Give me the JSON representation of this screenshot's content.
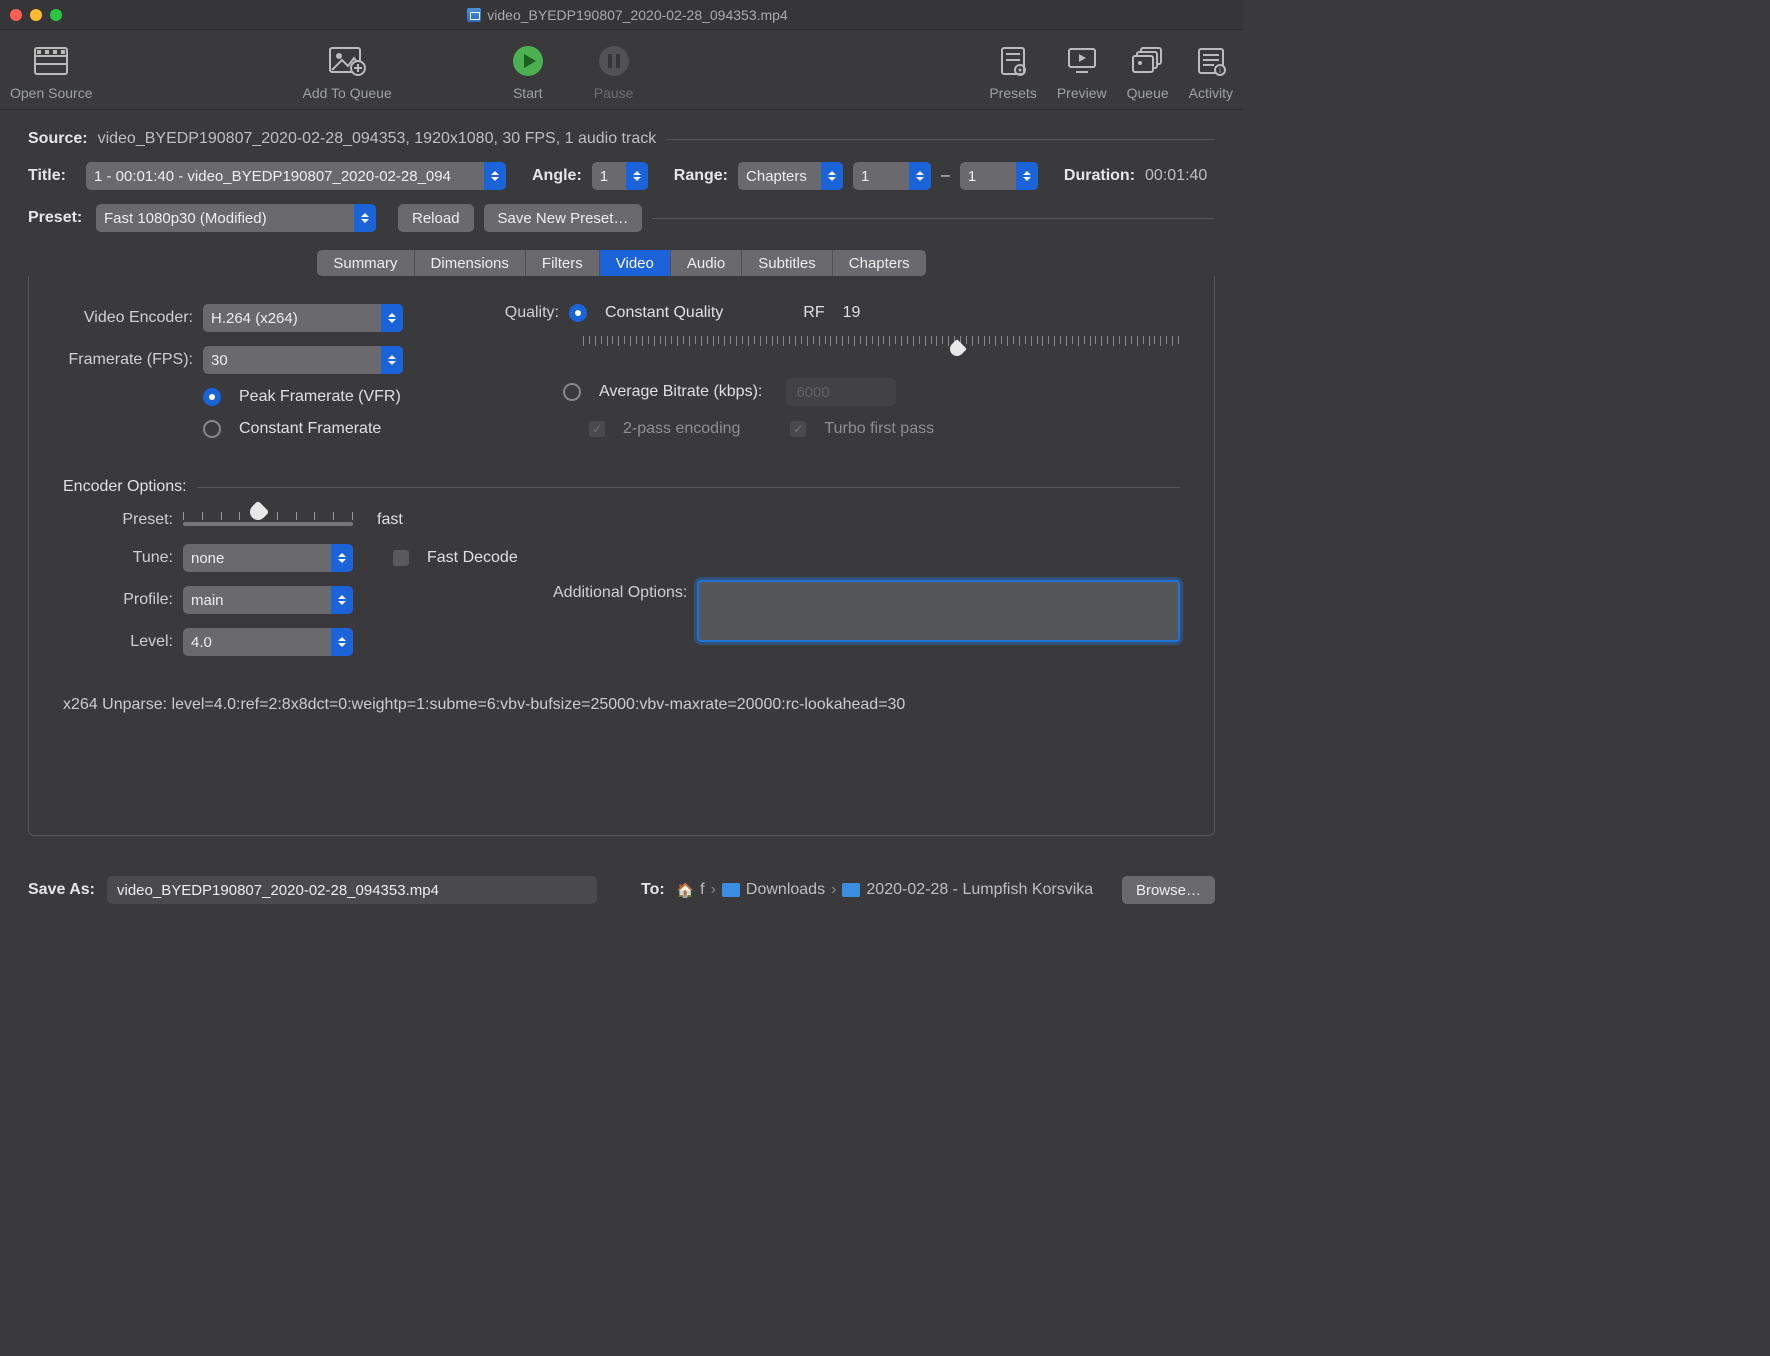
{
  "window": {
    "title": "video_BYEDP190807_2020-02-28_094353.mp4"
  },
  "toolbar": {
    "open_source": "Open Source",
    "add_to_queue": "Add To Queue",
    "start": "Start",
    "pause": "Pause",
    "presets": "Presets",
    "preview": "Preview",
    "queue": "Queue",
    "activity": "Activity"
  },
  "source": {
    "label": "Source:",
    "value": "video_BYEDP190807_2020-02-28_094353, 1920x1080, 30 FPS, 1 audio track"
  },
  "title": {
    "label": "Title:",
    "value": "1 - 00:01:40 - video_BYEDP190807_2020-02-28_094"
  },
  "angle": {
    "label": "Angle:",
    "value": "1"
  },
  "range": {
    "label": "Range:",
    "type": "Chapters",
    "from": "1",
    "sep": "–",
    "to": "1"
  },
  "duration": {
    "label": "Duration:",
    "value": "00:01:40"
  },
  "preset": {
    "label": "Preset:",
    "value": "Fast 1080p30 (Modified)",
    "reload": "Reload",
    "save_new": "Save New Preset…"
  },
  "tabs": [
    "Summary",
    "Dimensions",
    "Filters",
    "Video",
    "Audio",
    "Subtitles",
    "Chapters"
  ],
  "active_tab": "Video",
  "video": {
    "encoder_label": "Video Encoder:",
    "encoder_value": "H.264 (x264)",
    "fps_label": "Framerate (FPS):",
    "fps_value": "30",
    "peak_fr": "Peak Framerate (VFR)",
    "const_fr": "Constant Framerate",
    "quality_label": "Quality:",
    "cq": "Constant Quality",
    "rf_label": "RF",
    "rf_value": "19",
    "avg_bitrate": "Average Bitrate (kbps):",
    "bitrate_value": "6000",
    "two_pass": "2-pass encoding",
    "turbo": "Turbo first pass",
    "enc_opts": "Encoder Options:",
    "preset_label": "Preset:",
    "preset_value": "fast",
    "tune_label": "Tune:",
    "tune_value": "none",
    "fast_decode": "Fast Decode",
    "profile_label": "Profile:",
    "profile_value": "main",
    "add_opts_label": "Additional Options:",
    "add_opts_value": "",
    "level_label": "Level:",
    "level_value": "4.0",
    "unparse": "x264 Unparse: level=4.0:ref=2:8x8dct=0:weightp=1:subme=6:vbv-bufsize=25000:vbv-maxrate=20000:rc-lookahead=30"
  },
  "save": {
    "label": "Save As:",
    "filename": "video_BYEDP190807_2020-02-28_094353.mp4",
    "to_label": "To:",
    "path": [
      "f",
      "Downloads",
      "2020-02-28 - Lumpfish Korsvika"
    ],
    "browse": "Browse…"
  },
  "colors": {
    "close": "#ff5f57",
    "min": "#febc2e",
    "max": "#28c840",
    "accent": "#1a63d9"
  }
}
